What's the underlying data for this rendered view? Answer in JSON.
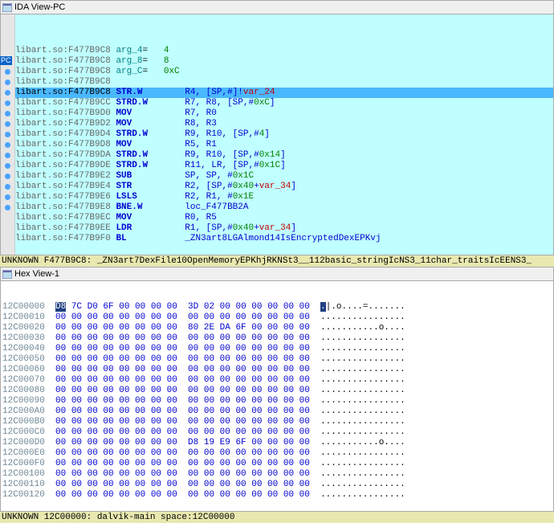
{
  "ida_view": {
    "title": "IDA View-PC",
    "pc_label": "PC",
    "lines": [
      {
        "addr": "libart.so:F477B9C8",
        "a": "arg_4",
        "av": "4",
        "dot": false
      },
      {
        "addr": "libart.so:F477B9C8",
        "a": "arg_8",
        "av": "8",
        "dot": false
      },
      {
        "addr": "libart.so:F477B9C8",
        "a": "arg_C",
        "av": "0xC",
        "dot": false
      },
      {
        "addr": "libart.so:F477B9C8",
        "blank": true,
        "dot": false
      },
      {
        "addr": "libart.so:F477B9C8",
        "mnem": "STR.W",
        "ops": "R4, [SP,#",
        "var": "var_24",
        "tail": "]!",
        "hl": true,
        "dot": true,
        "pc": true
      },
      {
        "addr": "libart.so:F477B9CC",
        "mnem": "STRD.W",
        "ops": "R7, R8, [SP,#",
        "num": "0xC",
        "tail": "]",
        "dot": true
      },
      {
        "addr": "libart.so:F477B9D0",
        "mnem": "MOV",
        "ops": "R7, R0",
        "dot": true
      },
      {
        "addr": "libart.so:F477B9D2",
        "mnem": "MOV",
        "ops": "R8, R3",
        "dot": true
      },
      {
        "addr": "libart.so:F477B9D4",
        "mnem": "STRD.W",
        "ops": "R9, R10, [SP,#",
        "num": "4",
        "tail": "]",
        "dot": true
      },
      {
        "addr": "libart.so:F477B9D8",
        "mnem": "MOV",
        "ops": "R5, R1",
        "dot": true
      },
      {
        "addr": "libart.so:F477B9DA",
        "mnem": "STRD.W",
        "ops": "R9, R10, [SP,#",
        "num": "0x14",
        "tail": "]",
        "dot": true
      },
      {
        "addr": "libart.so:F477B9DE",
        "mnem": "STRD.W",
        "ops": "R11, LR, [SP,#",
        "num": "0x1C",
        "tail": "]",
        "dot": true
      },
      {
        "addr": "libart.so:F477B9E2",
        "mnem": "SUB",
        "ops": "SP, SP, #",
        "num": "0x1C",
        "dot": true
      },
      {
        "addr": "libart.so:F477B9E4",
        "mnem": "STR",
        "ops": "R2, [SP,#",
        "num": "0x40",
        "tail": "+",
        "var": "var_34",
        "tail2": "]",
        "dot": true
      },
      {
        "addr": "libart.so:F477B9E6",
        "mnem": "LSLS",
        "ops": "R2, R1, #",
        "num": "0x1E",
        "dot": true
      },
      {
        "addr": "libart.so:F477B9E8",
        "mnem": "BNE.W",
        "ops": "",
        "call": "loc_F477BB2A",
        "dot": true
      },
      {
        "addr": "libart.so:F477B9EC",
        "mnem": "MOV",
        "ops": "R0, R5",
        "dot": true
      },
      {
        "addr": "libart.so:F477B9EE",
        "mnem": "LDR",
        "ops": "R1, [SP,#",
        "num": "0x40",
        "tail": "+",
        "var": "var_34",
        "tail2": "]",
        "dot": true
      },
      {
        "addr": "libart.so:F477B9F0",
        "mnem": "BL",
        "ops": "",
        "call": "_ZN3art8LGAlmond14IsEncryptedDexEPKvj",
        "dot": true
      }
    ],
    "unknown": "UNKNOWN F477B9C8: _ZN3art7DexFile10OpenMemoryEPKhjRKNSt3__112basic_stringIcNS3_11char_traitsIcEENS3_"
  },
  "hex_view": {
    "title": "Hex View-1",
    "lines": [
      {
        "addr": "12C00000",
        "b0": "D8",
        "b": "7C D0 6F 00 00 00 00  3D 02 00 00 00 00 00 00",
        "asc": ".|.o....=......."
      },
      {
        "addr": "12C00010",
        "b": "00 00 00 00 00 00 00 00  00 00 00 00 00 00 00 00",
        "asc": "................"
      },
      {
        "addr": "12C00020",
        "b": "00 00 00 00 00 00 00 00  80 2E DA 6F 00 00 00 00",
        "asc": "...........o...."
      },
      {
        "addr": "12C00030",
        "b": "00 00 00 00 00 00 00 00  00 00 00 00 00 00 00 00",
        "asc": "................"
      },
      {
        "addr": "12C00040",
        "b": "00 00 00 00 00 00 00 00  00 00 00 00 00 00 00 00",
        "asc": "................"
      },
      {
        "addr": "12C00050",
        "b": "00 00 00 00 00 00 00 00  00 00 00 00 00 00 00 00",
        "asc": "................"
      },
      {
        "addr": "12C00060",
        "b": "00 00 00 00 00 00 00 00  00 00 00 00 00 00 00 00",
        "asc": "................"
      },
      {
        "addr": "12C00070",
        "b": "00 00 00 00 00 00 00 00  00 00 00 00 00 00 00 00",
        "asc": "................"
      },
      {
        "addr": "12C00080",
        "b": "00 00 00 00 00 00 00 00  00 00 00 00 00 00 00 00",
        "asc": "................"
      },
      {
        "addr": "12C00090",
        "b": "00 00 00 00 00 00 00 00  00 00 00 00 00 00 00 00",
        "asc": "................"
      },
      {
        "addr": "12C000A0",
        "b": "00 00 00 00 00 00 00 00  00 00 00 00 00 00 00 00",
        "asc": "................"
      },
      {
        "addr": "12C000B0",
        "b": "00 00 00 00 00 00 00 00  00 00 00 00 00 00 00 00",
        "asc": "................"
      },
      {
        "addr": "12C000C0",
        "b": "00 00 00 00 00 00 00 00  00 00 00 00 00 00 00 00",
        "asc": "................"
      },
      {
        "addr": "12C000D0",
        "b": "00 00 00 00 00 00 00 00  D8 19 E9 6F 00 00 00 00",
        "asc": "...........o...."
      },
      {
        "addr": "12C000E0",
        "b": "00 00 00 00 00 00 00 00  00 00 00 00 00 00 00 00",
        "asc": "................"
      },
      {
        "addr": "12C000F0",
        "b": "00 00 00 00 00 00 00 00  00 00 00 00 00 00 00 00",
        "asc": "................"
      },
      {
        "addr": "12C00100",
        "b": "00 00 00 00 00 00 00 00  00 00 00 00 00 00 00 00",
        "asc": "................"
      },
      {
        "addr": "12C00110",
        "b": "00 00 00 00 00 00 00 00  00 00 00 00 00 00 00 00",
        "asc": "................"
      },
      {
        "addr": "12C00120",
        "b": "00 00 00 00 00 00 00 00  00 00 00 00 00 00 00 00",
        "asc": "................"
      }
    ],
    "unknown": "UNKNOWN 12C00000: dalvik-main space:12C00000"
  }
}
